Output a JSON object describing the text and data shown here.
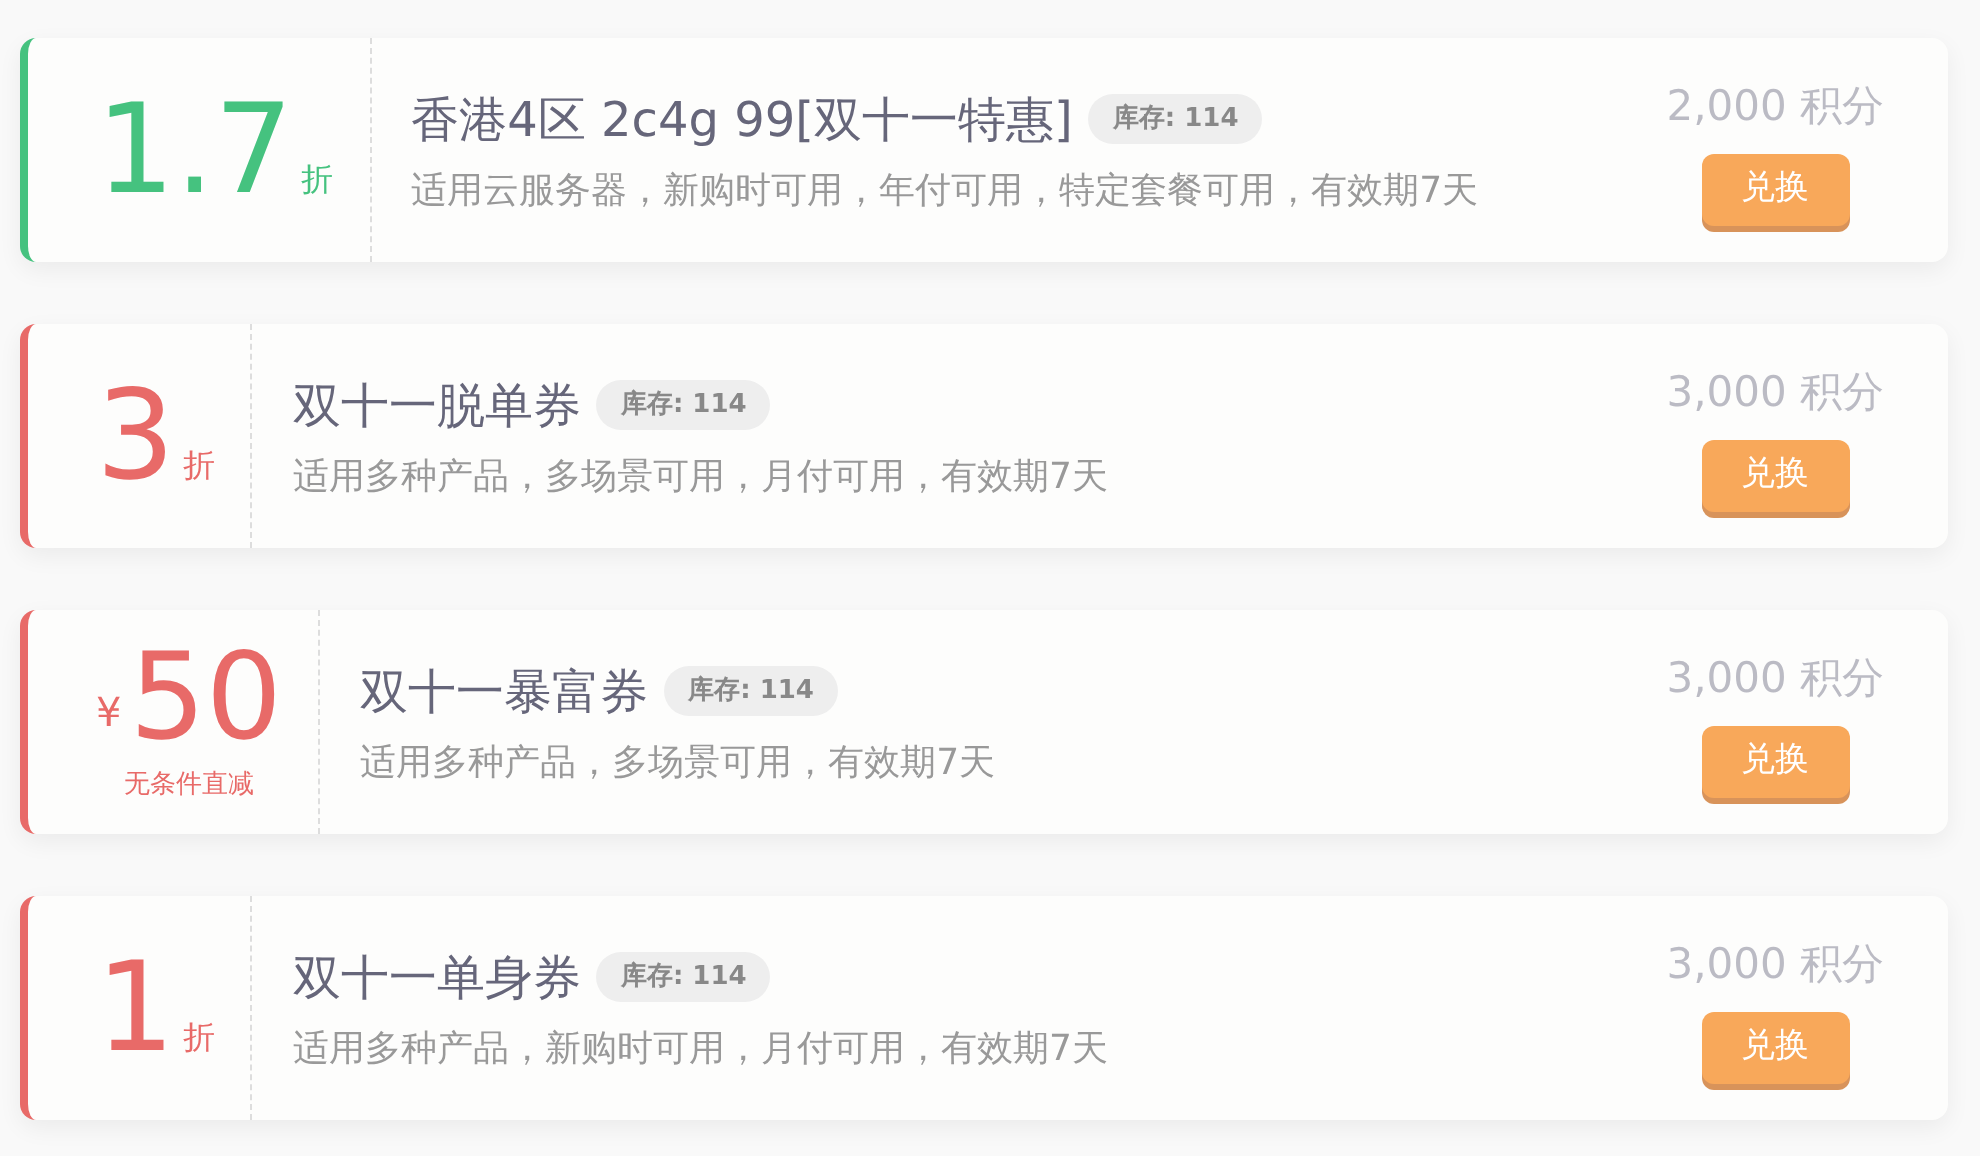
{
  "coupons": [
    {
      "kind": "discount",
      "color": "#45c27f",
      "value": "1.7",
      "unit": "折",
      "title": "香港4区 2c4g 99[双十一特惠]",
      "stock": "库存: 114",
      "description": "适用云服务器，新购时可用，年付可用，特定套餐可用，有效期7天",
      "points": "2,000 积分",
      "button": "兑换"
    },
    {
      "kind": "discount",
      "color": "#e86a68",
      "value": "3",
      "unit": "折",
      "title": "双十一脱单券",
      "stock": "库存: 114",
      "description": "适用多种产品，多场景可用，月付可用，有效期7天",
      "points": "3,000 积分",
      "button": "兑换"
    },
    {
      "kind": "cash",
      "color": "#e86a68",
      "currency": "¥",
      "value": "50",
      "note": "无条件直减",
      "title": "双十一暴富券",
      "stock": "库存: 114",
      "description": "适用多种产品，多场景可用，有效期7天",
      "points": "3,000 积分",
      "button": "兑换"
    },
    {
      "kind": "discount",
      "color": "#e86a68",
      "value": "1",
      "unit": "折",
      "title": "双十一单身券",
      "stock": "库存: 114",
      "description": "适用多种产品，新购时可用，月付可用，有效期7天",
      "points": "3,000 积分",
      "button": "兑换"
    }
  ]
}
